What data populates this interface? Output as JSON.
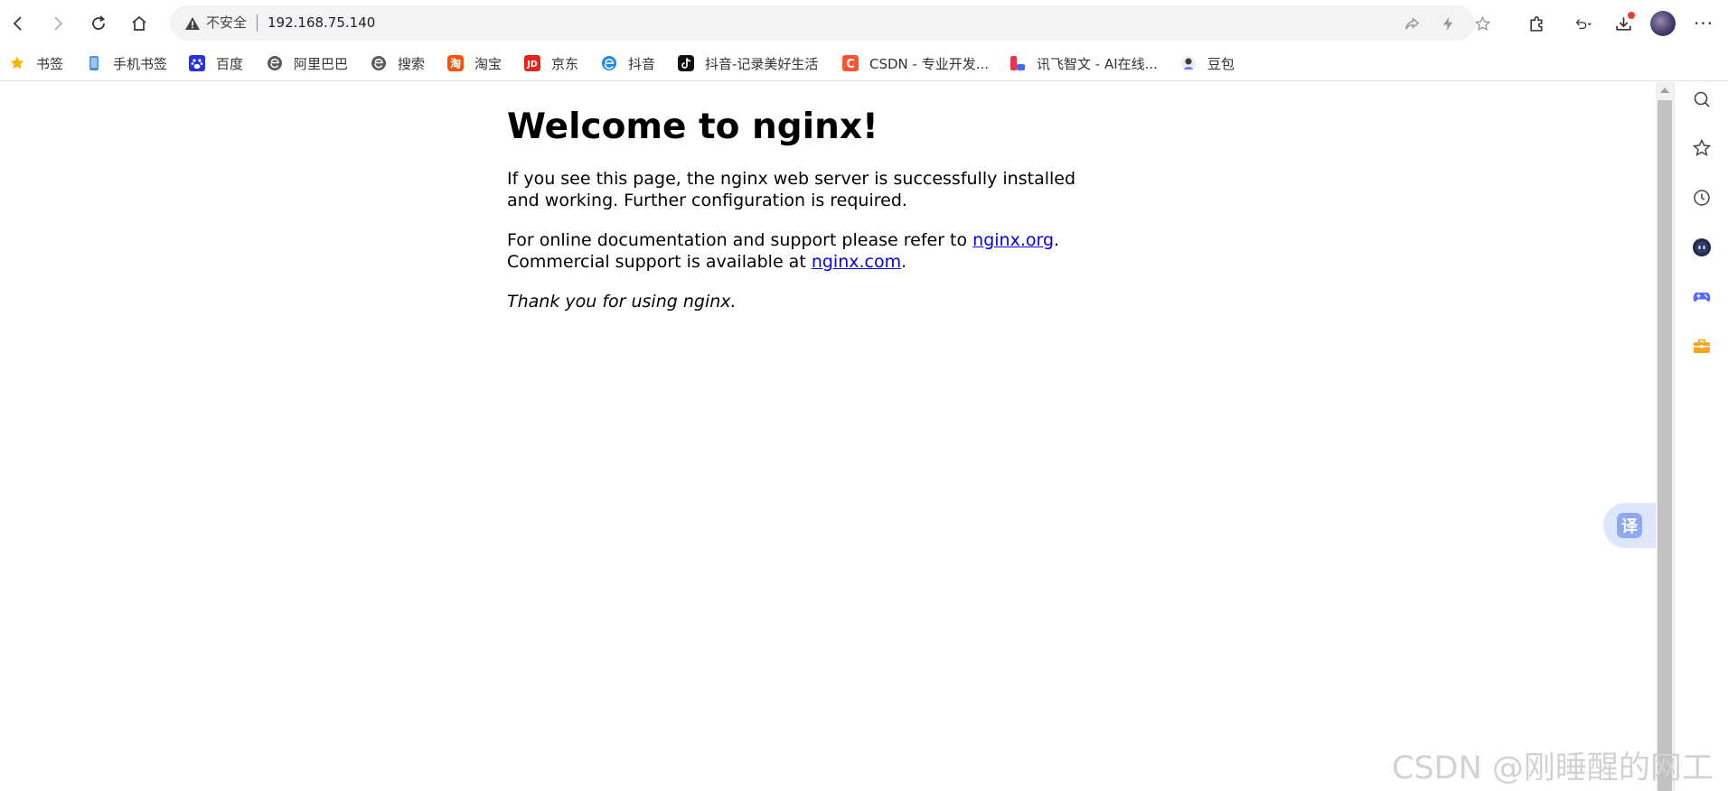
{
  "address_bar": {
    "security_label": "不安全",
    "url": "192.168.75.140"
  },
  "bookmarks": [
    {
      "label": "书签",
      "icon": "star-icon",
      "color": "#f7b500"
    },
    {
      "label": "手机书签",
      "icon": "phone-icon",
      "color": "#4a90e2"
    },
    {
      "label": "百度",
      "icon": "baidu-paw-icon",
      "color": "#2932e1"
    },
    {
      "label": "阿里巴巴",
      "icon": "browser-e-icon",
      "color": "#5b5b5b"
    },
    {
      "label": "搜索",
      "icon": "browser-e-icon",
      "color": "#5b5b5b"
    },
    {
      "label": "淘宝",
      "icon": "taobao-icon",
      "color": "#ff5000"
    },
    {
      "label": "京东",
      "icon": "jd-icon",
      "color": "#e1251b"
    },
    {
      "label": "抖音",
      "icon": "edge-icon",
      "color": "#1e88e5"
    },
    {
      "label": "抖音-记录美好生活",
      "icon": "tiktok-icon",
      "color": "#111111"
    },
    {
      "label": "CSDN - 专业开发...",
      "icon": "csdn-icon",
      "color": "#fc5531"
    },
    {
      "label": "讯飞智文 - AI在线...",
      "icon": "xunfei-icon",
      "color": "#e8344e"
    },
    {
      "label": "豆包",
      "icon": "doubao-icon",
      "color": "#6b7cff"
    }
  ],
  "page": {
    "heading": "Welcome to nginx!",
    "p1": "If you see this page, the nginx web server is successfully installed and working. Further configuration is required.",
    "p2_text_1": "For online documentation and support please refer to ",
    "p2_link_1": "nginx.org",
    "p2_text_2": ".",
    "p2_text_3": "Commercial support is available at ",
    "p2_link_2": "nginx.com",
    "p2_text_4": ".",
    "p3": "Thank you for using nginx."
  },
  "translate": {
    "label": "译"
  },
  "watermark": "CSDN @刚睡醒的网工"
}
